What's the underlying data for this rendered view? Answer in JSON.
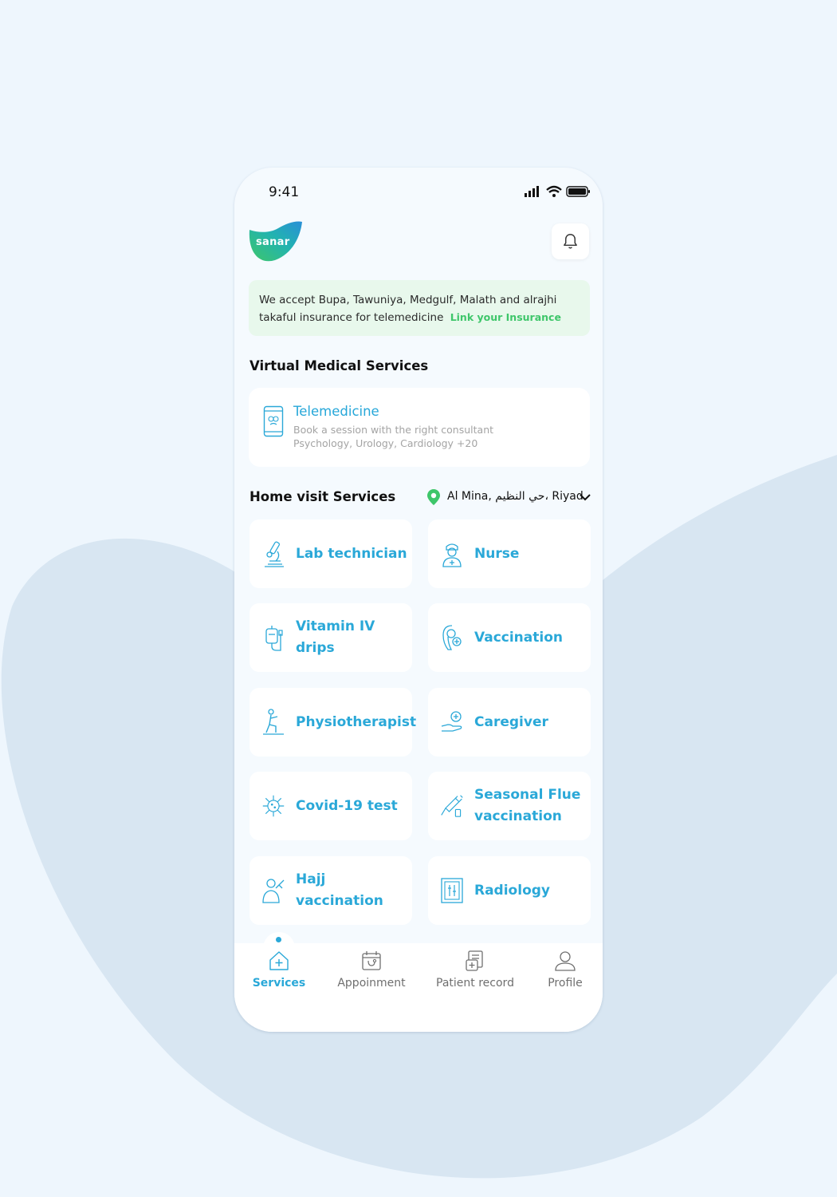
{
  "status_bar": {
    "time": "9:41"
  },
  "brand": {
    "name": "sanar"
  },
  "insurance": {
    "text": "We accept Bupa, Tawuniya, Medgulf, Malath and alrajhi takaful insurance for telemedicine",
    "link": "Link your Insurance"
  },
  "virtual_section": {
    "title": "Virtual Medical Services",
    "telemedicine": {
      "title": "Telemedicine",
      "subtitle": "Book a session with the right consultant",
      "specialties": "Psychology,  Urology, Cardiology  +20"
    }
  },
  "home_section": {
    "title": "Home visit Services",
    "location": "Al Mina, حي النظيم، Riyadh"
  },
  "services": [
    {
      "label": "Lab technician",
      "icon": "microscope-icon"
    },
    {
      "label": "Nurse",
      "icon": "nurse-icon"
    },
    {
      "label": "Vitamin IV drips",
      "icon": "iv-drip-icon"
    },
    {
      "label": "Vaccination",
      "icon": "vaccination-icon"
    },
    {
      "label": "Physiotherapist",
      "icon": "physiotherapy-icon"
    },
    {
      "label": "Caregiver",
      "icon": "caregiver-icon"
    },
    {
      "label": "Covid-19 test",
      "icon": "virus-icon"
    },
    {
      "label": "Seasonal Flue vaccination",
      "icon": "syringe-icon"
    },
    {
      "label": "Hajj vaccination",
      "icon": "hajj-icon"
    },
    {
      "label": "Radiology",
      "icon": "xray-icon"
    }
  ],
  "nav": {
    "services": "Services",
    "appointment": "Appoinment",
    "patient_record": "Patient record",
    "profile": "Profile"
  },
  "colors": {
    "accent": "#2aa8d8",
    "brand_green": "#3ec66a",
    "banner_bg": "#e8f8ec"
  }
}
